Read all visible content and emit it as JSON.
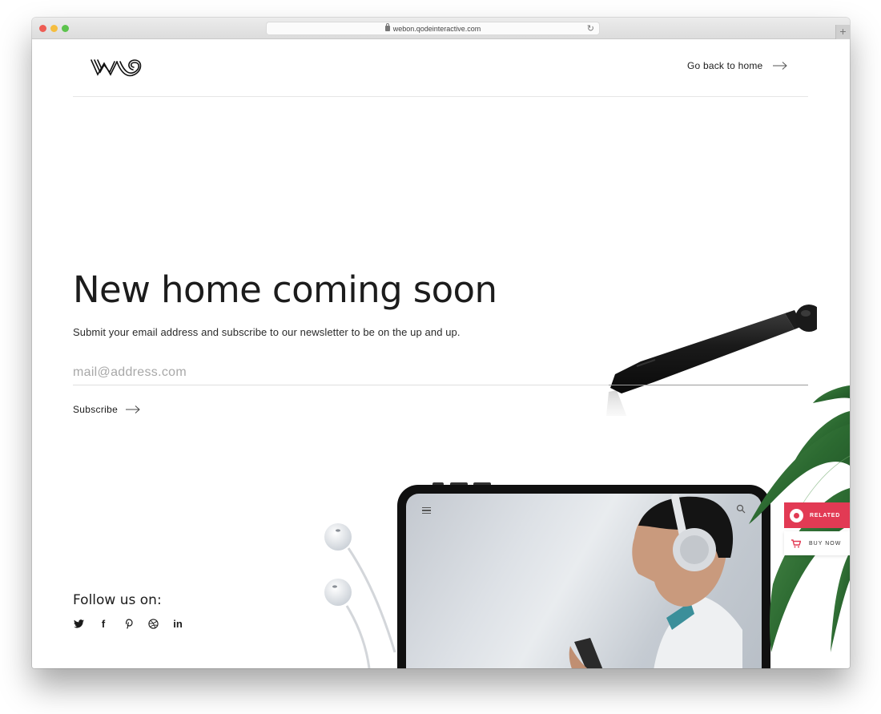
{
  "browser": {
    "url": "webon.qodeinteractive.com",
    "traffic_lights": [
      "close",
      "minimize",
      "zoom"
    ],
    "new_tab_label": "+"
  },
  "header": {
    "logo_alt": "Webon logo",
    "back_link": "Go back to home"
  },
  "hero": {
    "title": "New home coming soon",
    "subtitle": "Submit your email address and subscribe to our newsletter to be on the up and up.",
    "email": {
      "placeholder": "mail@address.com",
      "value": ""
    },
    "subscribe_label": "Subscribe"
  },
  "social": {
    "heading": "Follow us on:",
    "links": [
      {
        "icon": "twitter-icon",
        "glyph": ""
      },
      {
        "icon": "facebook-icon",
        "glyph": "f"
      },
      {
        "icon": "pinterest-icon",
        "glyph": ""
      },
      {
        "icon": "dribbble-icon",
        "glyph": ""
      },
      {
        "icon": "linkedin-icon",
        "glyph": "in"
      }
    ]
  },
  "side_widgets": {
    "related_label": "RELATED",
    "buy_now_label": "BUY NOW",
    "accent_color": "#e23a54"
  }
}
